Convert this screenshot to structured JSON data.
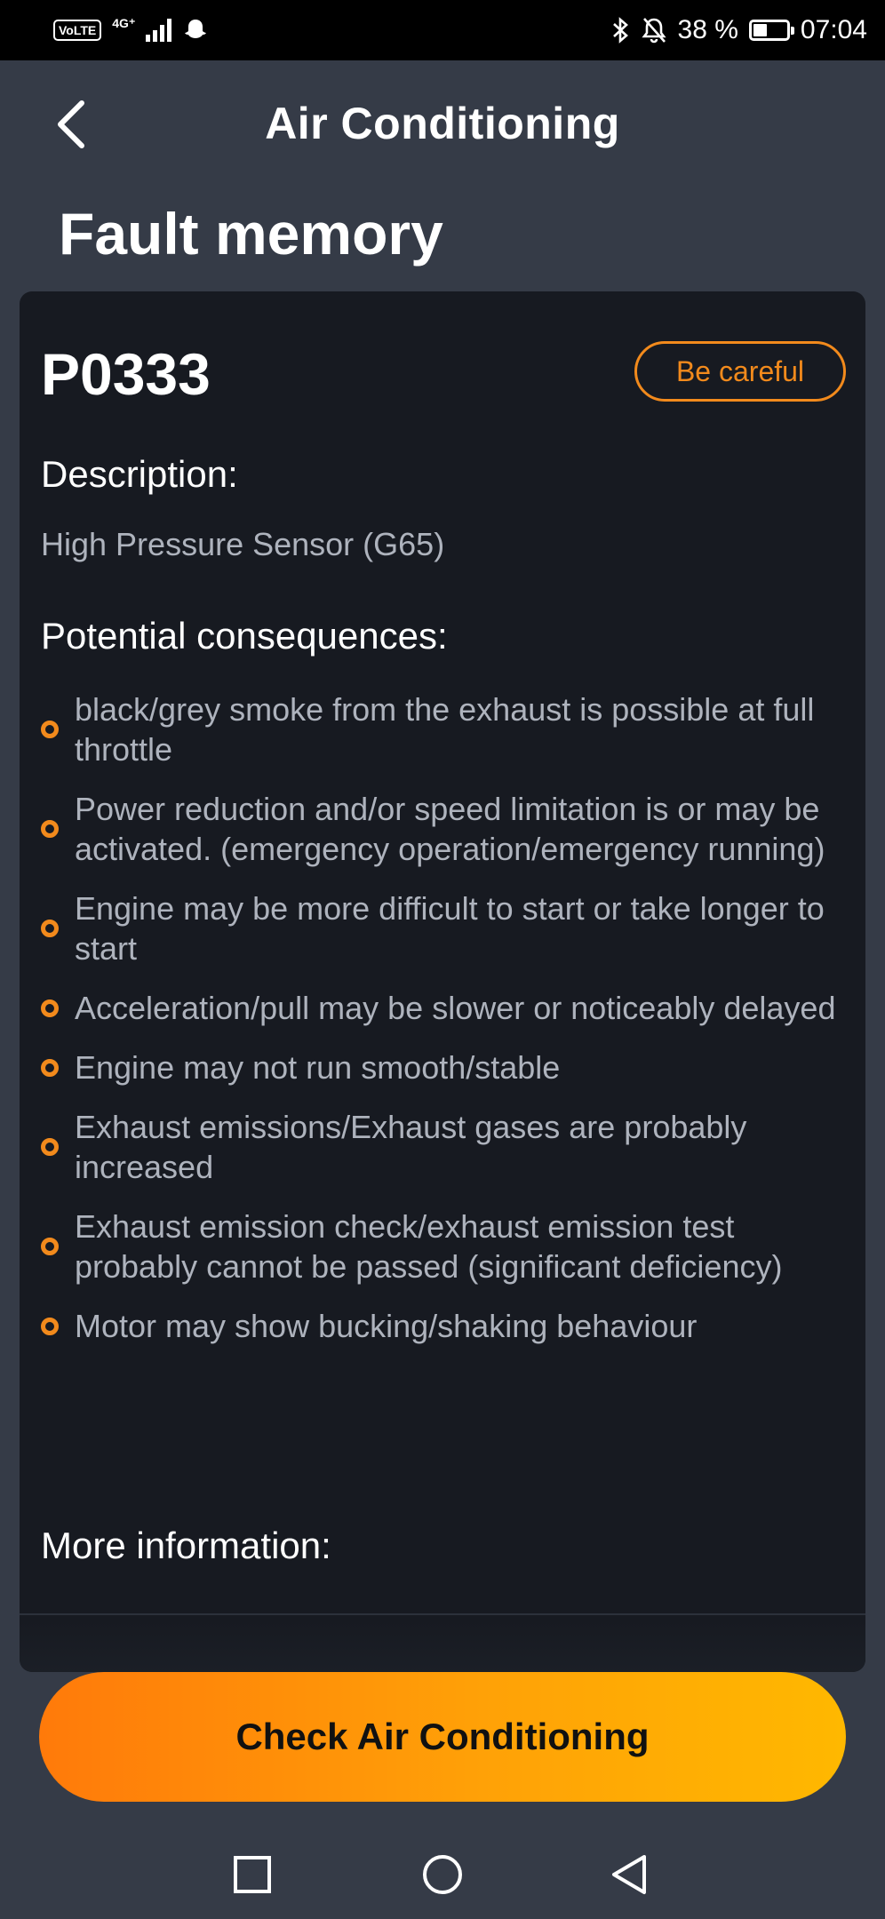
{
  "status_bar": {
    "volte": "VoLTE",
    "network": "4G⁺",
    "battery_percent": "38 %",
    "battery_level": 0.38,
    "time": "07:04",
    "icons": [
      "bluetooth-icon",
      "bell-off-icon",
      "ghost-icon"
    ]
  },
  "header": {
    "back_icon": "chevron-left-icon",
    "title": "Air Conditioning"
  },
  "page_title": "Fault memory",
  "fault": {
    "code": "P0333",
    "severity": "Be careful",
    "severity_color": "#f28a1c",
    "description_label": "Description:",
    "description": "High Pressure Sensor (G65)",
    "consequences_label": "Potential consequences:",
    "consequences": [
      "black/grey smoke from the exhaust is possible at full throttle",
      "Power reduction and/or speed limitation is or may be activated. (emergency operation/emergency running)",
      "Engine may be more difficult to start or take longer to start",
      "Acceleration/pull may be slower or noticeably delayed",
      "Engine may not run smooth/stable",
      "Exhaust emissions/Exhaust gases are probably increased",
      "Exhaust emission check/exhaust emission test probably cannot be passed (significant deficiency)",
      "Motor may show bucking/shaking behaviour"
    ],
    "more_info_label": "More information:"
  },
  "cta": {
    "label": "Check Air Conditioning",
    "gradient": [
      "#ff7a0a",
      "#ffb800"
    ]
  },
  "nav_bar": {
    "icons": [
      "recents-square-icon",
      "home-circle-icon",
      "back-triangle-icon"
    ]
  },
  "colors": {
    "background": "#353b47",
    "card": "#171a21",
    "accent": "#f28a1c",
    "muted_text": "#aeb3bd"
  }
}
